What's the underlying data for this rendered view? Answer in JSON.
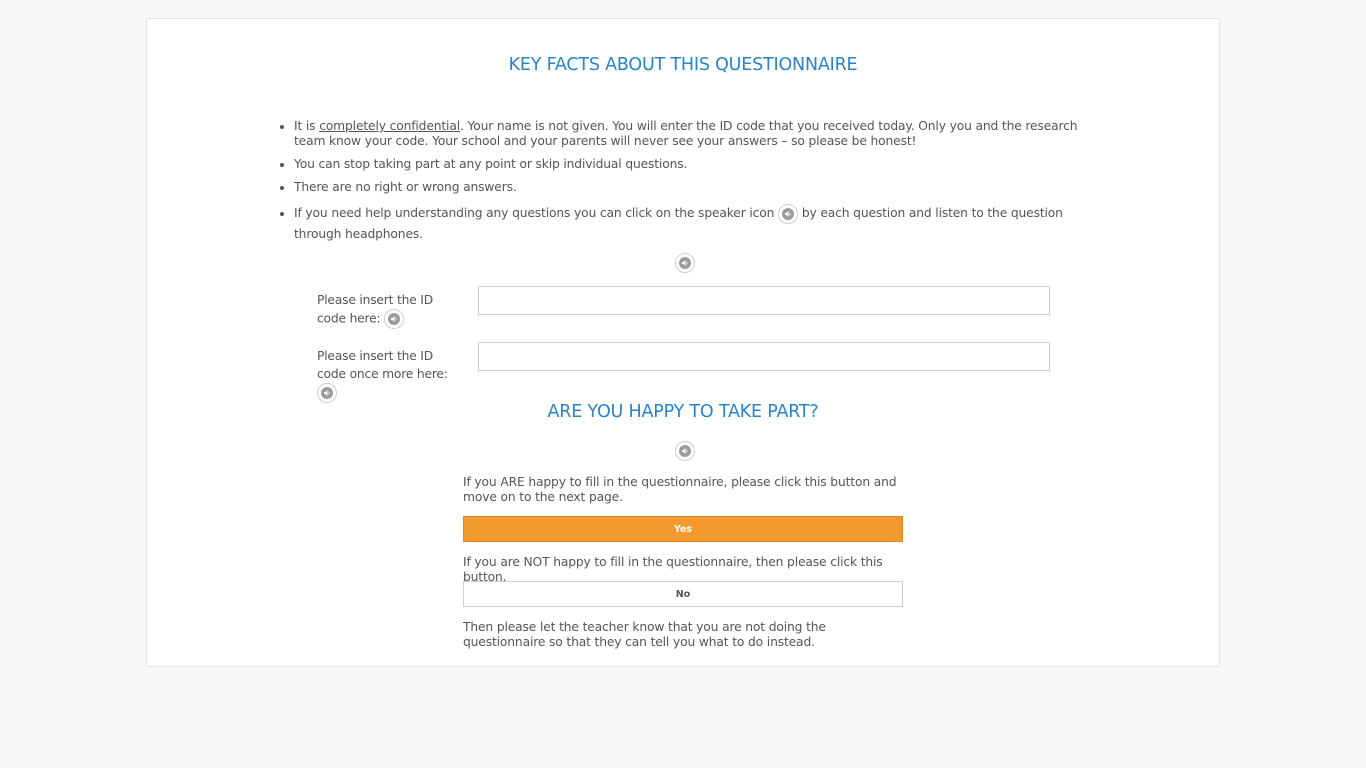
{
  "header": {
    "title": "KEY FACTS ABOUT THIS QUESTIONNAIRE"
  },
  "facts": {
    "item1_prefix": "It is ",
    "item1_underlined": "completely confidential",
    "item1_rest": ". Your name is not given. You will enter the ID code that you received today. Only you and the research team know your code. Your school and your parents will never see your answers – so please be honest!",
    "item2": "You can stop taking part at any point or skip individual questions.",
    "item3": "There are no right or wrong answers.",
    "item4_before": "If you need help understanding any questions you can click on the speaker icon",
    "item4_after": "by each question and listen to the question through headphones."
  },
  "id_form": {
    "label1": "Please insert the ID code here:",
    "label2": "Please insert the ID code once more here:",
    "value1": "",
    "value2": ""
  },
  "consent": {
    "title": "ARE YOU HAPPY TO TAKE PART?",
    "yes_text": "If you ARE happy to fill in the questionnaire, please click this button and move on to the next page.",
    "yes_label": "Yes",
    "no_text": "If you are NOT happy to fill in the questionnaire, then please click this button.",
    "no_label": "No",
    "footer_text": "Then please let the teacher know that you are not doing the questionnaire so that they can tell you what to do instead."
  },
  "icons": {
    "speaker": "speaker-icon"
  },
  "colors": {
    "title": "#2a83c6",
    "yes_button": "#f39a2e",
    "background": "#f8f8f8"
  }
}
